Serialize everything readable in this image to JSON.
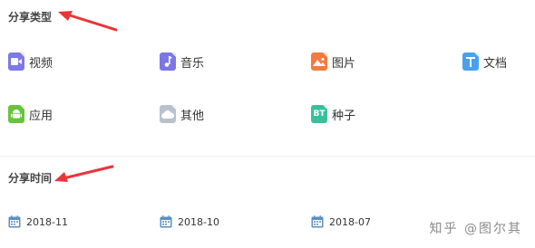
{
  "sections": {
    "share_type": {
      "title": "分享类型",
      "items": [
        {
          "label": "视频",
          "icon": "video-icon",
          "color": "#7d79e6"
        },
        {
          "label": "音乐",
          "icon": "music-icon",
          "color": "#7b77e3"
        },
        {
          "label": "图片",
          "icon": "image-icon",
          "color": "#f37b3c"
        },
        {
          "label": "文档",
          "icon": "document-icon",
          "color": "#4aa0ec"
        },
        {
          "label": "应用",
          "icon": "android-icon",
          "color": "#68c33a"
        },
        {
          "label": "其他",
          "icon": "cloud-icon",
          "color": "#b8c2cc"
        },
        {
          "label": "种子",
          "icon": "torrent-icon",
          "color": "#38c09c",
          "glyph": "BT"
        }
      ]
    },
    "share_time": {
      "title": "分享时间",
      "items": [
        {
          "label": "2018-11",
          "icon": "calendar-icon"
        },
        {
          "label": "2018-10",
          "icon": "calendar-icon"
        },
        {
          "label": "2018-07",
          "icon": "calendar-icon"
        }
      ]
    }
  },
  "watermark": "知乎 @图尔其",
  "colors": {
    "arrow": "#e8353a",
    "calendar": "#5b8fc6",
    "divider": "#eef0f3"
  }
}
